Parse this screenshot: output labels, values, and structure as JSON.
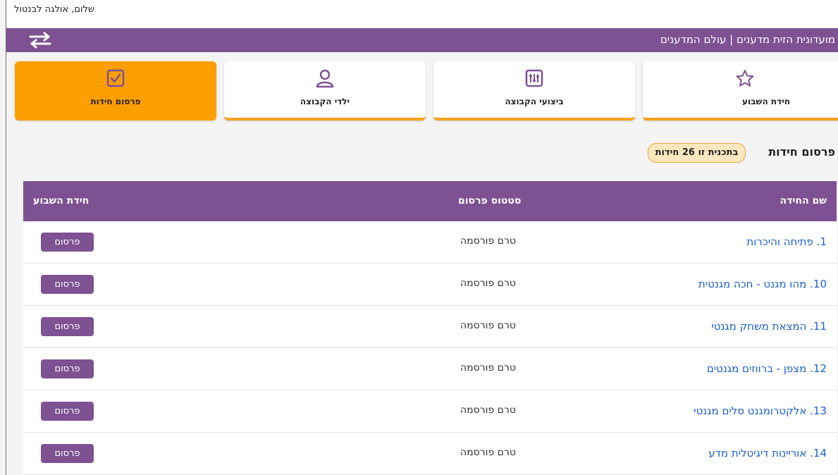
{
  "header": {
    "greeting": "שלום, אולגה לבנטול",
    "site_title": "מועדונית הזית מדענים | עולם המדענים"
  },
  "nav_cards": [
    {
      "label": "פרסום חידות",
      "icon": "checkbox-icon",
      "active": true
    },
    {
      "label": "ילדי הקבוצה",
      "icon": "user-icon",
      "active": false
    },
    {
      "label": "ביצועי הקבוצה",
      "icon": "sliders-icon",
      "active": false
    },
    {
      "label": "חידת השבוע",
      "icon": "star-icon",
      "active": false
    }
  ],
  "section": {
    "title": "פרסום חידות",
    "count_badge": "בתכנית זו 26 חידות"
  },
  "table": {
    "columns": {
      "name": "שם החידה",
      "status": "סטטוס פרסום",
      "week": "חידת השבוע"
    },
    "rows": [
      {
        "name": "1. פתיחה והיכרות",
        "status": "טרם פורסמה",
        "action": "פרסום"
      },
      {
        "name": "10. מהו מגנט - חכה מגנטית",
        "status": "טרם פורסמה",
        "action": "פרסום"
      },
      {
        "name": "11. המצאת משחק מגנטי",
        "status": "טרם פורסמה",
        "action": "פרסום"
      },
      {
        "name": "12. מצפן - ברווזים מגנטים",
        "status": "טרם פורסמה",
        "action": "פרסום"
      },
      {
        "name": "13. אלקטרומגנט סלים מגנטי",
        "status": "טרם פורסמה",
        "action": "פרסום"
      },
      {
        "name": "14. אוריינות דיגיטלית מדע",
        "status": "טרם פורסמה",
        "action": "פרסום"
      }
    ]
  },
  "colors": {
    "purple": "#7e5192",
    "orange": "#ff9e00",
    "link_blue": "#1b5fd2",
    "badge_bg": "#ffe7bf"
  }
}
